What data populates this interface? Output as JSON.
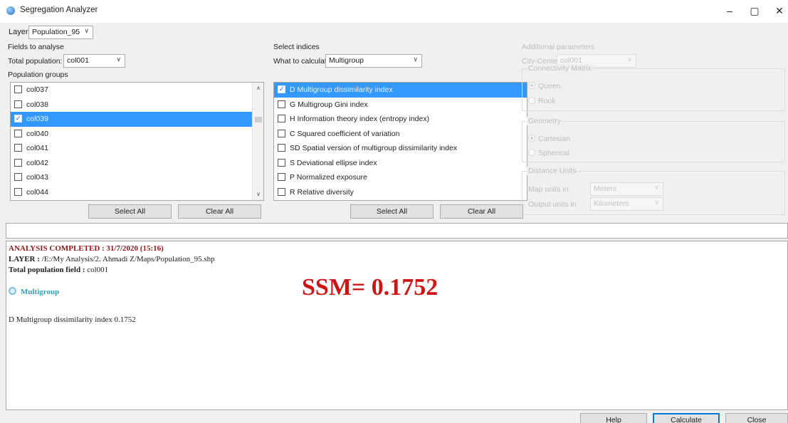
{
  "window": {
    "title": "Segregation Analyzer",
    "controls": {
      "minimize": "–",
      "maximize": "▢",
      "close": "✕"
    }
  },
  "layer": {
    "label": "Layer",
    "value": "Population_95"
  },
  "fields": {
    "header": "Fields to analyse",
    "total_population_label": "Total population:",
    "total_population_value": "col001",
    "groups_label": "Population groups",
    "groups": [
      {
        "label": "col037",
        "checked": false,
        "selected": false
      },
      {
        "label": "col038",
        "checked": false,
        "selected": false
      },
      {
        "label": "col039",
        "checked": true,
        "selected": true
      },
      {
        "label": "col040",
        "checked": false,
        "selected": false
      },
      {
        "label": "col041",
        "checked": false,
        "selected": false
      },
      {
        "label": "col042",
        "checked": false,
        "selected": false
      },
      {
        "label": "col043",
        "checked": false,
        "selected": false
      },
      {
        "label": "col044",
        "checked": false,
        "selected": false
      }
    ],
    "select_all": "Select All",
    "clear_all": "Clear All"
  },
  "indices": {
    "header": "Select indices",
    "what_label": "What to calculate:",
    "what_value": "Multigroup",
    "items": [
      {
        "label": "D Multigroup dissimilarity index",
        "checked": true,
        "selected": true
      },
      {
        "label": "G Multigroup Gini index",
        "checked": false,
        "selected": false
      },
      {
        "label": "H Information theory index (entropy index)",
        "checked": false,
        "selected": false
      },
      {
        "label": "C Squared coefficient of variation",
        "checked": false,
        "selected": false
      },
      {
        "label": "SD Spatial version of multigroup dissimilarity index",
        "checked": false,
        "selected": false
      },
      {
        "label": "S Deviational ellipse index",
        "checked": false,
        "selected": false
      },
      {
        "label": "P Normalized exposure",
        "checked": false,
        "selected": false
      },
      {
        "label": "R Relative diversity",
        "checked": false,
        "selected": false
      }
    ],
    "select_all": "Select All",
    "clear_all": "Clear All"
  },
  "additional": {
    "header": "Additional parameters",
    "city_center_label": "City-Center",
    "city_center_value": "col001",
    "connectivity": {
      "title": "Connectivity Matrix",
      "options": [
        "Queen",
        "Rook"
      ],
      "selected": "Queen"
    },
    "geometry": {
      "title": "Geometry",
      "options": [
        "Cartesian",
        "Spherical"
      ],
      "selected": "Cartesian"
    },
    "distance": {
      "title": "Distance Units",
      "map_units_label": "Map units in",
      "map_units_value": "Meters",
      "output_units_label": "Output units in",
      "output_units_value": "Kilometers"
    }
  },
  "results": {
    "status": "ANALYSIS COMPLETED : 31/7/2020 (15:16)",
    "layer_label": "LAYER :",
    "layer_path": "/E:/My Analysis/2. Ahmadi Z/Maps/Population_95.shp",
    "total_label": "Total population field :",
    "total_value": "col001",
    "section": "Multigroup",
    "index_line": "D Multigroup dissimilarity index  0.1752",
    "ssm": "SSM= 0.1752"
  },
  "footer": {
    "help": "Help",
    "calculate": "Calculate",
    "close": "Close"
  },
  "colors": {
    "selection": "#3399ff",
    "status": "#8b1a1a",
    "ssm": "#cc1616",
    "section": "#3a9bb5"
  }
}
